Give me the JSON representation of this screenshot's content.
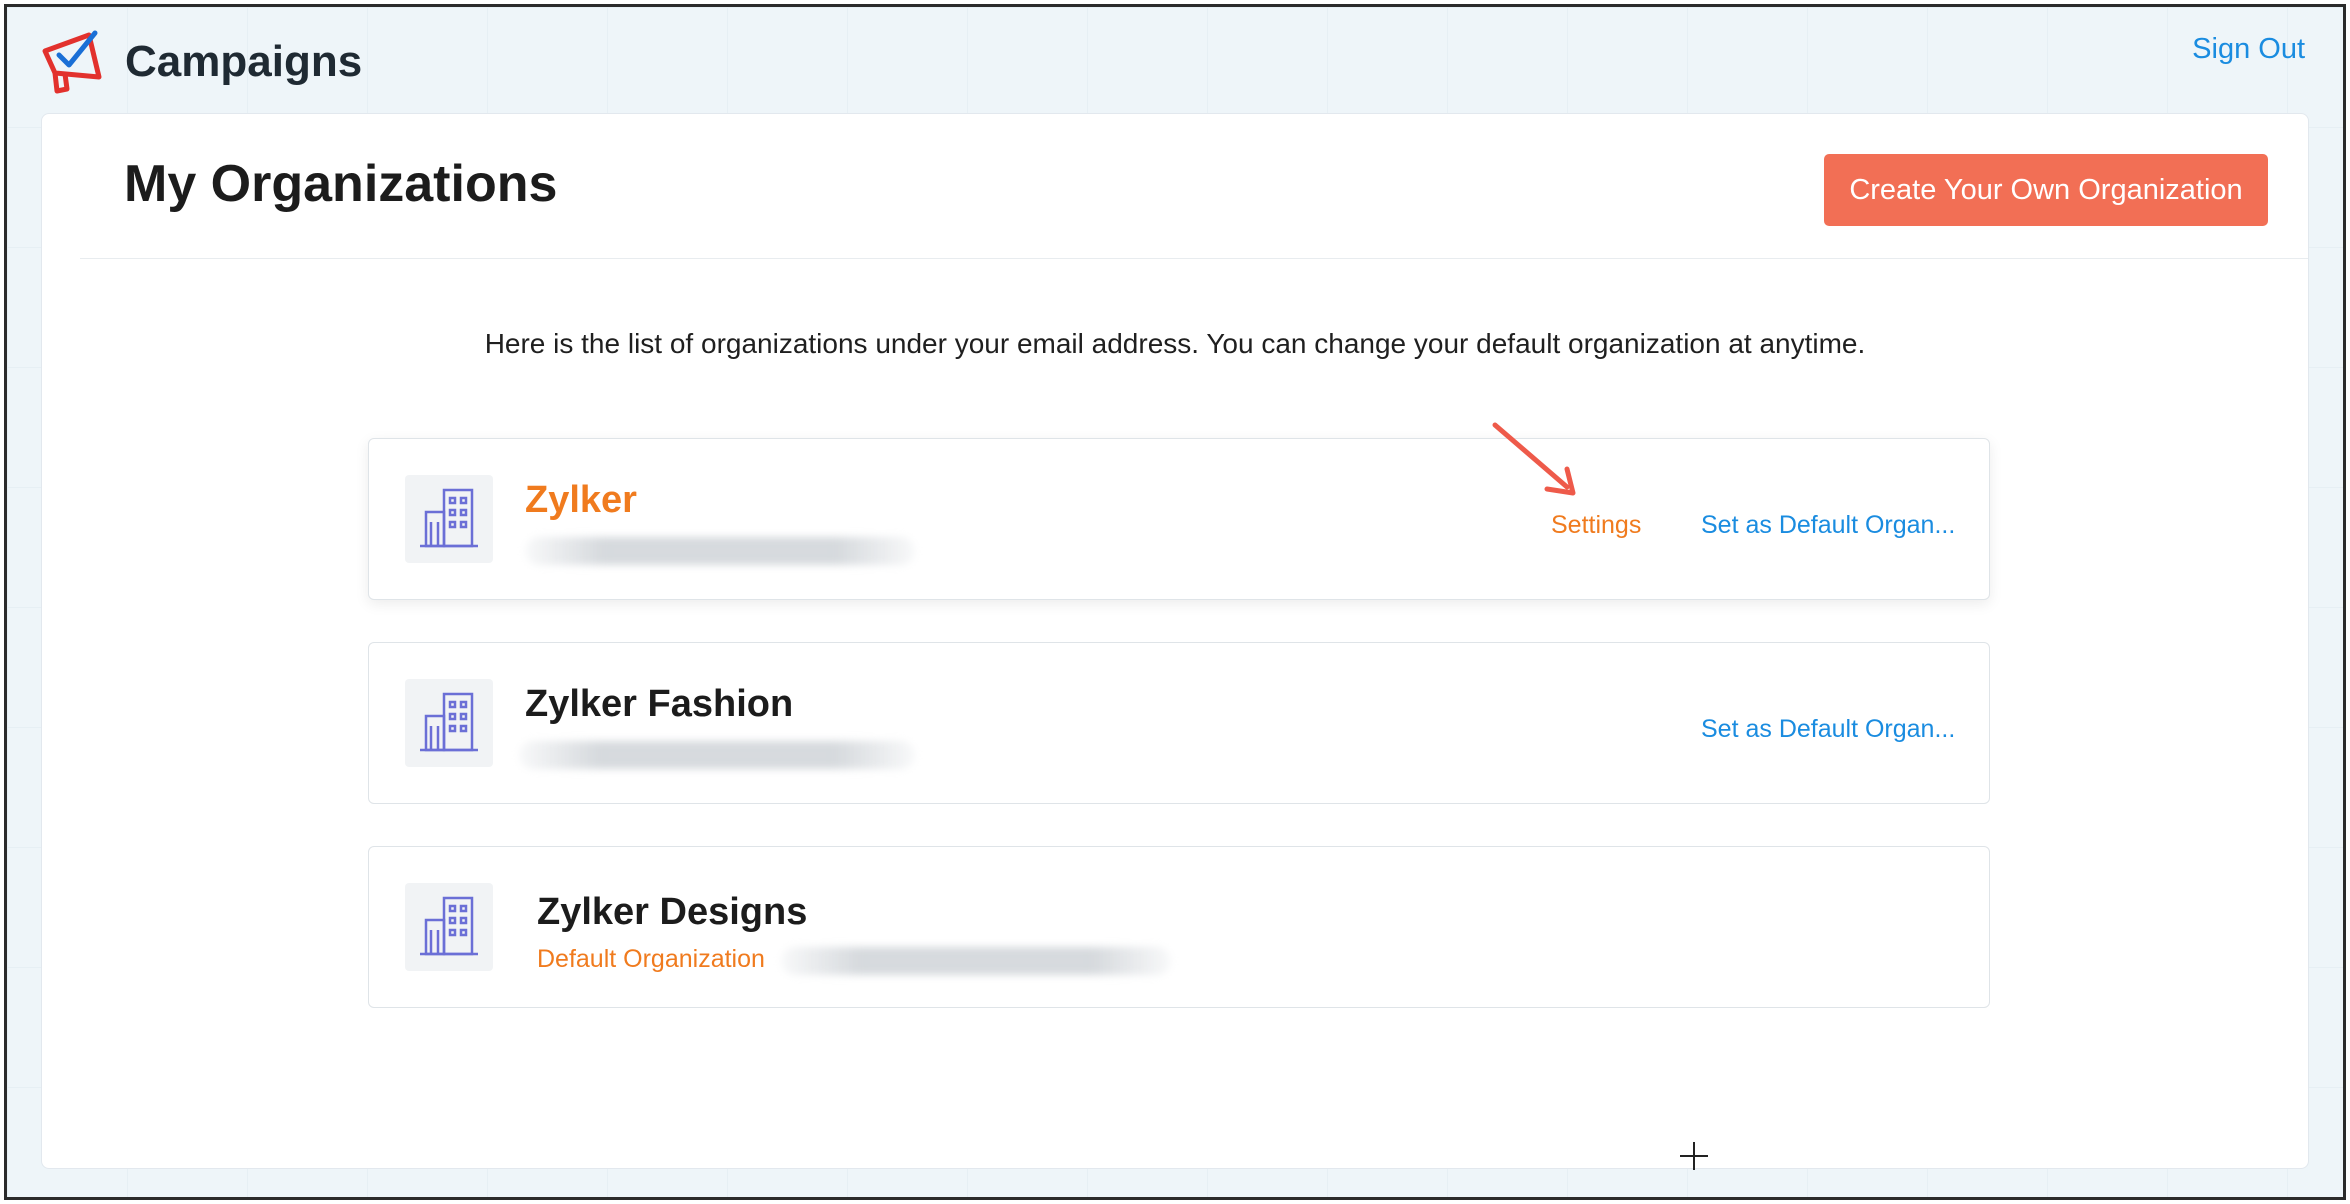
{
  "header": {
    "app_title": "Campaigns",
    "sign_out_label": "Sign Out",
    "logo_icon": "megaphone-check-icon"
  },
  "main": {
    "page_title": "My Organizations",
    "create_button_label": "Create Your Own Organization",
    "intro_text": "Here is the list of organizations under your email address. You can change your default organization at anytime."
  },
  "organizations": [
    {
      "name": "Zylker",
      "settings_label": "Settings",
      "default_link_label": "Set as Default Organ..."
    },
    {
      "name": "Zylker Fashion",
      "default_link_label": "Set as Default Organ..."
    },
    {
      "name": "Zylker Designs",
      "default_badge": "Default Organization"
    }
  ],
  "colors": {
    "accent_orange": "#f07b1e",
    "link_blue": "#1a8ce0",
    "button_bg": "#f26f55",
    "icon_purple": "#6b6fd6",
    "arrow_red": "#ee5a4a"
  }
}
